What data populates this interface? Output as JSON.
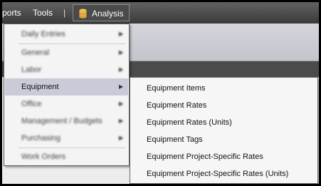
{
  "menubar": {
    "reports_label": "ports",
    "tools_label": "Tools",
    "separator": "|",
    "analysis_label": "Analysis"
  },
  "analysis_menu": {
    "items": [
      {
        "label": "Daily Entries",
        "submenu": true,
        "blurred": true
      },
      {
        "label": "General",
        "submenu": true,
        "blurred": true
      },
      {
        "label": "Labor",
        "submenu": true,
        "blurred": true
      },
      {
        "label": "Equipment",
        "submenu": true,
        "blurred": false
      },
      {
        "label": "Office",
        "submenu": true,
        "blurred": true
      },
      {
        "label": "Management / Budgets",
        "submenu": true,
        "blurred": true
      },
      {
        "label": "Purchasing",
        "submenu": true,
        "blurred": true
      },
      {
        "label": "Work Orders",
        "submenu": false,
        "blurred": true
      }
    ],
    "arrow": "▶"
  },
  "equipment_submenu": {
    "items": [
      "Equipment Items",
      "Equipment Rates",
      "Equipment Rates (Units)",
      "Equipment Tags",
      "Equipment Project-Specific Rates",
      "Equipment Project-Specific Rates (Units)"
    ]
  },
  "colors": {
    "menubar_bg": "#4a4a4a",
    "highlight": "#c9ccd8",
    "menu_bg": "#f4f4f4"
  },
  "icons": {
    "analysis_icon": "database-icon",
    "submenu_arrow": "chevron-right-icon"
  }
}
